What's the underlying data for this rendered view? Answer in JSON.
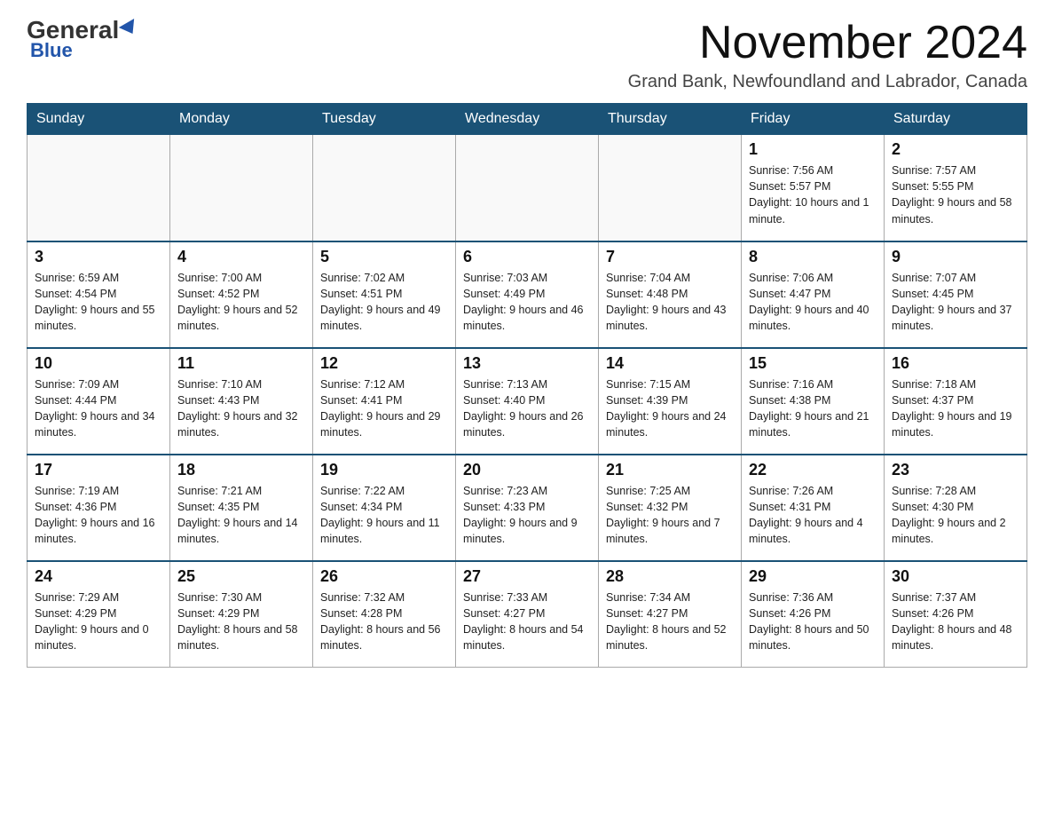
{
  "logo": {
    "general": "General",
    "blue": "Blue"
  },
  "header": {
    "month_year": "November 2024",
    "location": "Grand Bank, Newfoundland and Labrador, Canada"
  },
  "days_of_week": [
    "Sunday",
    "Monday",
    "Tuesday",
    "Wednesday",
    "Thursday",
    "Friday",
    "Saturday"
  ],
  "weeks": [
    [
      {
        "day": "",
        "sunrise": "",
        "sunset": "",
        "daylight": ""
      },
      {
        "day": "",
        "sunrise": "",
        "sunset": "",
        "daylight": ""
      },
      {
        "day": "",
        "sunrise": "",
        "sunset": "",
        "daylight": ""
      },
      {
        "day": "",
        "sunrise": "",
        "sunset": "",
        "daylight": ""
      },
      {
        "day": "",
        "sunrise": "",
        "sunset": "",
        "daylight": ""
      },
      {
        "day": "1",
        "sunrise": "Sunrise: 7:56 AM",
        "sunset": "Sunset: 5:57 PM",
        "daylight": "Daylight: 10 hours and 1 minute."
      },
      {
        "day": "2",
        "sunrise": "Sunrise: 7:57 AM",
        "sunset": "Sunset: 5:55 PM",
        "daylight": "Daylight: 9 hours and 58 minutes."
      }
    ],
    [
      {
        "day": "3",
        "sunrise": "Sunrise: 6:59 AM",
        "sunset": "Sunset: 4:54 PM",
        "daylight": "Daylight: 9 hours and 55 minutes."
      },
      {
        "day": "4",
        "sunrise": "Sunrise: 7:00 AM",
        "sunset": "Sunset: 4:52 PM",
        "daylight": "Daylight: 9 hours and 52 minutes."
      },
      {
        "day": "5",
        "sunrise": "Sunrise: 7:02 AM",
        "sunset": "Sunset: 4:51 PM",
        "daylight": "Daylight: 9 hours and 49 minutes."
      },
      {
        "day": "6",
        "sunrise": "Sunrise: 7:03 AM",
        "sunset": "Sunset: 4:49 PM",
        "daylight": "Daylight: 9 hours and 46 minutes."
      },
      {
        "day": "7",
        "sunrise": "Sunrise: 7:04 AM",
        "sunset": "Sunset: 4:48 PM",
        "daylight": "Daylight: 9 hours and 43 minutes."
      },
      {
        "day": "8",
        "sunrise": "Sunrise: 7:06 AM",
        "sunset": "Sunset: 4:47 PM",
        "daylight": "Daylight: 9 hours and 40 minutes."
      },
      {
        "day": "9",
        "sunrise": "Sunrise: 7:07 AM",
        "sunset": "Sunset: 4:45 PM",
        "daylight": "Daylight: 9 hours and 37 minutes."
      }
    ],
    [
      {
        "day": "10",
        "sunrise": "Sunrise: 7:09 AM",
        "sunset": "Sunset: 4:44 PM",
        "daylight": "Daylight: 9 hours and 34 minutes."
      },
      {
        "day": "11",
        "sunrise": "Sunrise: 7:10 AM",
        "sunset": "Sunset: 4:43 PM",
        "daylight": "Daylight: 9 hours and 32 minutes."
      },
      {
        "day": "12",
        "sunrise": "Sunrise: 7:12 AM",
        "sunset": "Sunset: 4:41 PM",
        "daylight": "Daylight: 9 hours and 29 minutes."
      },
      {
        "day": "13",
        "sunrise": "Sunrise: 7:13 AM",
        "sunset": "Sunset: 4:40 PM",
        "daylight": "Daylight: 9 hours and 26 minutes."
      },
      {
        "day": "14",
        "sunrise": "Sunrise: 7:15 AM",
        "sunset": "Sunset: 4:39 PM",
        "daylight": "Daylight: 9 hours and 24 minutes."
      },
      {
        "day": "15",
        "sunrise": "Sunrise: 7:16 AM",
        "sunset": "Sunset: 4:38 PM",
        "daylight": "Daylight: 9 hours and 21 minutes."
      },
      {
        "day": "16",
        "sunrise": "Sunrise: 7:18 AM",
        "sunset": "Sunset: 4:37 PM",
        "daylight": "Daylight: 9 hours and 19 minutes."
      }
    ],
    [
      {
        "day": "17",
        "sunrise": "Sunrise: 7:19 AM",
        "sunset": "Sunset: 4:36 PM",
        "daylight": "Daylight: 9 hours and 16 minutes."
      },
      {
        "day": "18",
        "sunrise": "Sunrise: 7:21 AM",
        "sunset": "Sunset: 4:35 PM",
        "daylight": "Daylight: 9 hours and 14 minutes."
      },
      {
        "day": "19",
        "sunrise": "Sunrise: 7:22 AM",
        "sunset": "Sunset: 4:34 PM",
        "daylight": "Daylight: 9 hours and 11 minutes."
      },
      {
        "day": "20",
        "sunrise": "Sunrise: 7:23 AM",
        "sunset": "Sunset: 4:33 PM",
        "daylight": "Daylight: 9 hours and 9 minutes."
      },
      {
        "day": "21",
        "sunrise": "Sunrise: 7:25 AM",
        "sunset": "Sunset: 4:32 PM",
        "daylight": "Daylight: 9 hours and 7 minutes."
      },
      {
        "day": "22",
        "sunrise": "Sunrise: 7:26 AM",
        "sunset": "Sunset: 4:31 PM",
        "daylight": "Daylight: 9 hours and 4 minutes."
      },
      {
        "day": "23",
        "sunrise": "Sunrise: 7:28 AM",
        "sunset": "Sunset: 4:30 PM",
        "daylight": "Daylight: 9 hours and 2 minutes."
      }
    ],
    [
      {
        "day": "24",
        "sunrise": "Sunrise: 7:29 AM",
        "sunset": "Sunset: 4:29 PM",
        "daylight": "Daylight: 9 hours and 0 minutes."
      },
      {
        "day": "25",
        "sunrise": "Sunrise: 7:30 AM",
        "sunset": "Sunset: 4:29 PM",
        "daylight": "Daylight: 8 hours and 58 minutes."
      },
      {
        "day": "26",
        "sunrise": "Sunrise: 7:32 AM",
        "sunset": "Sunset: 4:28 PM",
        "daylight": "Daylight: 8 hours and 56 minutes."
      },
      {
        "day": "27",
        "sunrise": "Sunrise: 7:33 AM",
        "sunset": "Sunset: 4:27 PM",
        "daylight": "Daylight: 8 hours and 54 minutes."
      },
      {
        "day": "28",
        "sunrise": "Sunrise: 7:34 AM",
        "sunset": "Sunset: 4:27 PM",
        "daylight": "Daylight: 8 hours and 52 minutes."
      },
      {
        "day": "29",
        "sunrise": "Sunrise: 7:36 AM",
        "sunset": "Sunset: 4:26 PM",
        "daylight": "Daylight: 8 hours and 50 minutes."
      },
      {
        "day": "30",
        "sunrise": "Sunrise: 7:37 AM",
        "sunset": "Sunset: 4:26 PM",
        "daylight": "Daylight: 8 hours and 48 minutes."
      }
    ]
  ]
}
